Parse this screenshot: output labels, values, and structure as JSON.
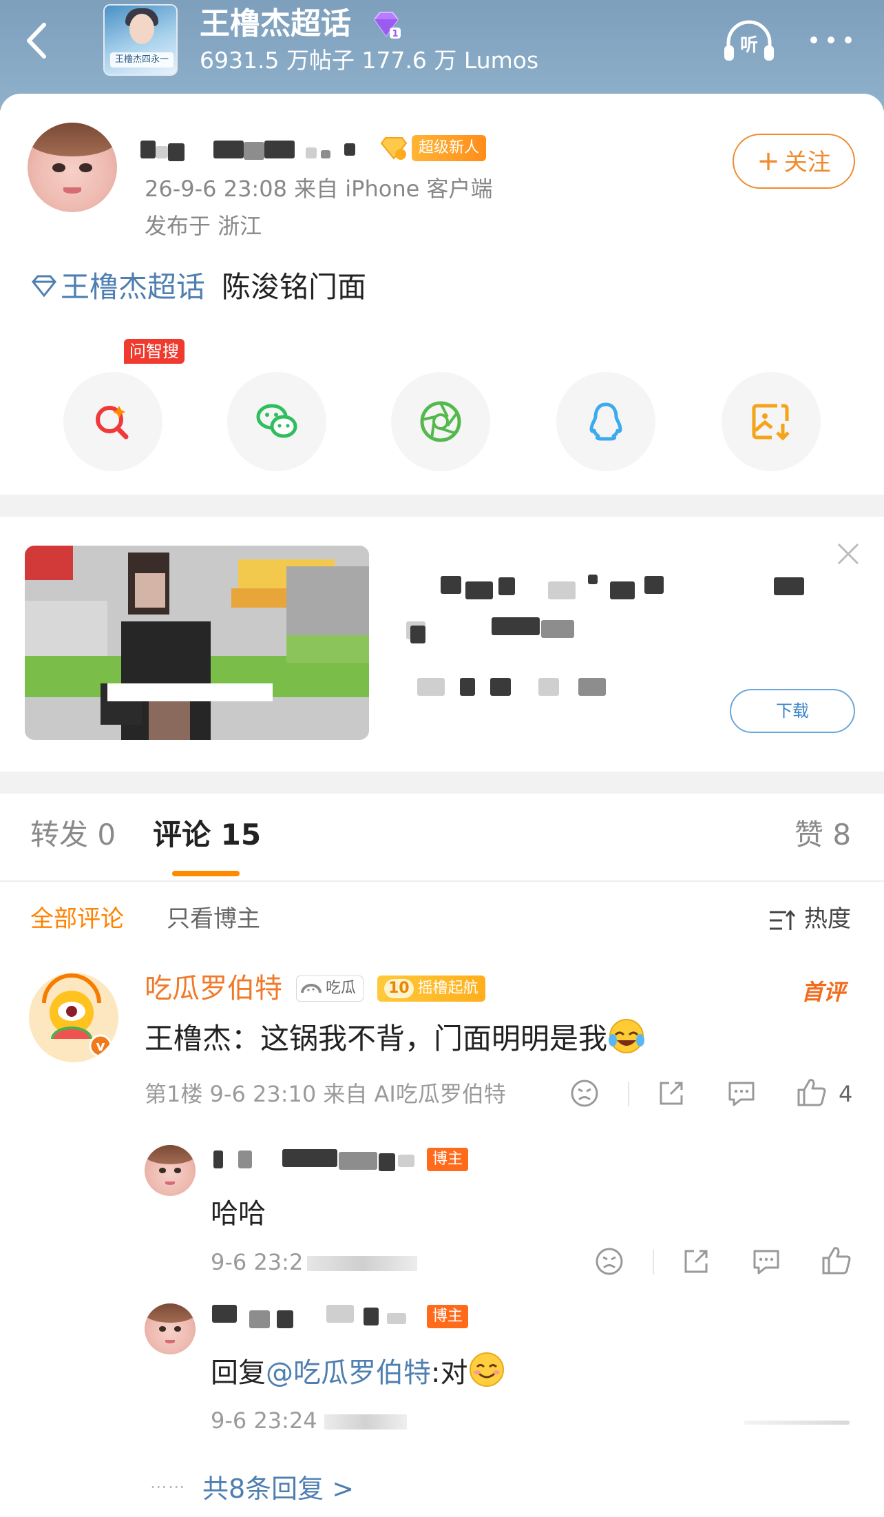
{
  "header": {
    "forum_title": "王橹杰超话",
    "stats": "6931.5 万帖子 177.6 万 Lumos",
    "cover_caption": "王橹杰四永一"
  },
  "post": {
    "badge_label": "超级新人",
    "time_source": "26-9-6 23:08  来自 iPhone 客户端",
    "location": "发布于 浙江",
    "follow_label": "关注",
    "topic_link": "王橹杰超话",
    "text": "陈浚铭门面",
    "ask_tag": "问智搜"
  },
  "ad": {
    "download_label": "下载"
  },
  "tabs": {
    "repost": "转发 0",
    "comment": "评论 15",
    "like": "赞 8"
  },
  "filters": {
    "all": "全部评论",
    "owner_only": "只看博主",
    "sort": "热度"
  },
  "comment": {
    "author": "吃瓜罗伯特",
    "badge_tag": "吃瓜",
    "badge_level": "10",
    "badge_level_label": "摇橹起航",
    "first_tag": "首评",
    "text": "王橹杰：这锅我不背，门面明明是我",
    "meta": "第1楼 9-6 23:10 来自 AI吃瓜罗伯特",
    "likes": "4"
  },
  "replies": [
    {
      "owner_tag": "博主",
      "text": "哈哈",
      "meta": "9-6 23:2"
    },
    {
      "owner_tag": "博主",
      "text_prefix": "回复",
      "mention": "@吃瓜罗伯特",
      "text_suffix": ":对",
      "meta": "9-6 23:24"
    }
  ],
  "more_replies": "共8条回复 >",
  "colors": {
    "accent_orange": "#ff8200",
    "link_blue": "#4f7fb1",
    "header_blue": "#8aabc6"
  }
}
